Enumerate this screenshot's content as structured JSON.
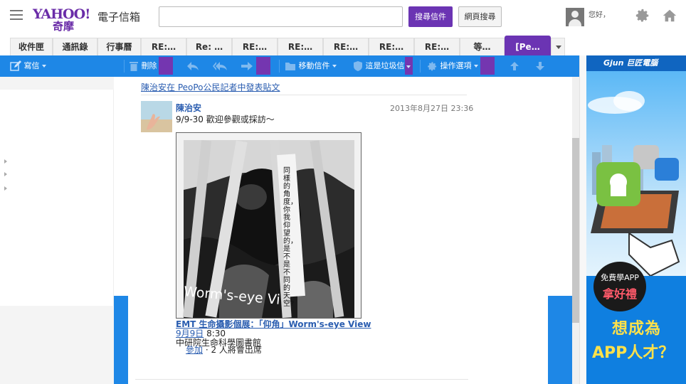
{
  "header": {
    "logo_yahoo": "YAHOO!",
    "logo_kimo": "奇摩",
    "product": "電子信箱",
    "search_mail_label": "搜尋信件",
    "search_web_label": "網頁搜尋",
    "greeting": "您好，"
  },
  "tabs": [
    {
      "label": "收件匣"
    },
    {
      "label": "通訊錄"
    },
    {
      "label": "行事曆"
    },
    {
      "label": "RE:…"
    },
    {
      "label": "Re: …"
    },
    {
      "label": "RE:…"
    },
    {
      "label": "RE:…"
    },
    {
      "label": "RE:…"
    },
    {
      "label": "RE:…"
    },
    {
      "label": "RE:…"
    },
    {
      "label": "等…"
    },
    {
      "label": "[Pe…",
      "active": true
    }
  ],
  "toolbar": {
    "compose_label": "寫信",
    "delete_label": "刪除",
    "move_label": "移動信件",
    "spam_label": "這是垃圾信",
    "actions_label": "操作選項"
  },
  "message": {
    "header_link": "陳治安在 PeoPo公民記者中發表貼文",
    "author": "陳治安",
    "time": "2013年8月27日 23:36",
    "text": "9/9-30 歡迎參觀或採訪～",
    "image_caption_vertical": "同樣的角度，你我仰望的，是不是不同的天空?",
    "image_caption_en": "Worm's-eye Vi",
    "event_title": "EMT 生命攝影個展：「仰角」Worm's-eye View",
    "event_date": "9月9日",
    "event_time": "8:30",
    "event_place": "中研院生命科學圖書館",
    "event_join": "參加",
    "event_attendees": "· 2 人將會出席"
  },
  "ad": {
    "brand": "巨匠電腦",
    "brand_prefix": "Gjun",
    "bubble_line1": "免費學APP",
    "bubble_line2": "拿好禮",
    "headline1": "想成為",
    "headline2": "APP人才？"
  },
  "colors": {
    "brand_purple": "#6b34b3",
    "toolbar_blue": "#1e87e6",
    "link_blue": "#2a5db0"
  }
}
